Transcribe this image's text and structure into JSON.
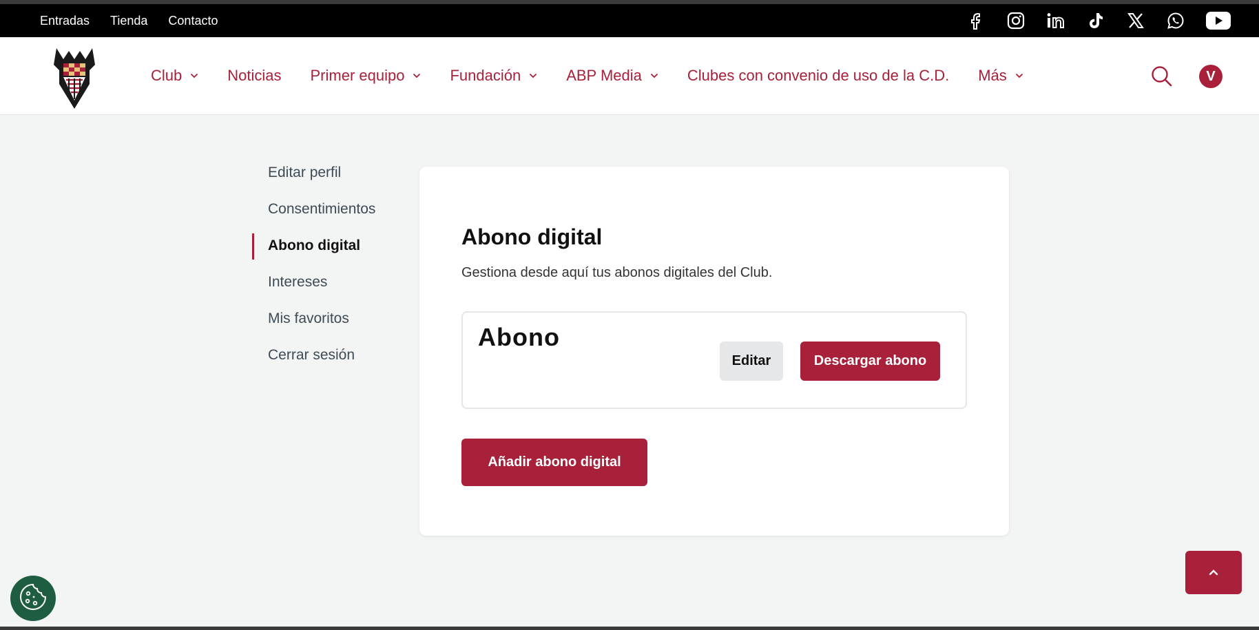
{
  "topbar": {
    "links": [
      "Entradas",
      "Tienda",
      "Contacto"
    ],
    "social_icons": [
      "facebook-icon",
      "instagram-icon",
      "linkedin-icon",
      "tiktok-icon",
      "x-icon",
      "whatsapp-icon",
      "youtube-icon"
    ]
  },
  "nav": {
    "items": [
      {
        "label": "Club",
        "dropdown": true
      },
      {
        "label": "Noticias",
        "dropdown": false
      },
      {
        "label": "Primer equipo",
        "dropdown": true
      },
      {
        "label": "Fundación",
        "dropdown": true
      },
      {
        "label": "ABP Media",
        "dropdown": true
      },
      {
        "label": "Clubes con convenio de uso de la C.D.",
        "dropdown": false
      },
      {
        "label": "Más",
        "dropdown": true
      }
    ],
    "avatar_initial": "V"
  },
  "sidebar": {
    "items": [
      {
        "label": "Editar perfil",
        "active": false
      },
      {
        "label": "Consentimientos",
        "active": false
      },
      {
        "label": "Abono digital",
        "active": true
      },
      {
        "label": "Intereses",
        "active": false
      },
      {
        "label": "Mis favoritos",
        "active": false
      },
      {
        "label": "Cerrar sesión",
        "active": false
      }
    ]
  },
  "main": {
    "title": "Abono digital",
    "description": "Gestiona desde aquí tus abonos digitales del Club.",
    "abono_card": {
      "name": "Abono",
      "edit_label": "Editar",
      "download_label": "Descargar abono"
    },
    "add_label": "Añadir abono digital"
  },
  "colors": {
    "brand": "#a8203a",
    "cookie_button": "#1f5d43"
  }
}
